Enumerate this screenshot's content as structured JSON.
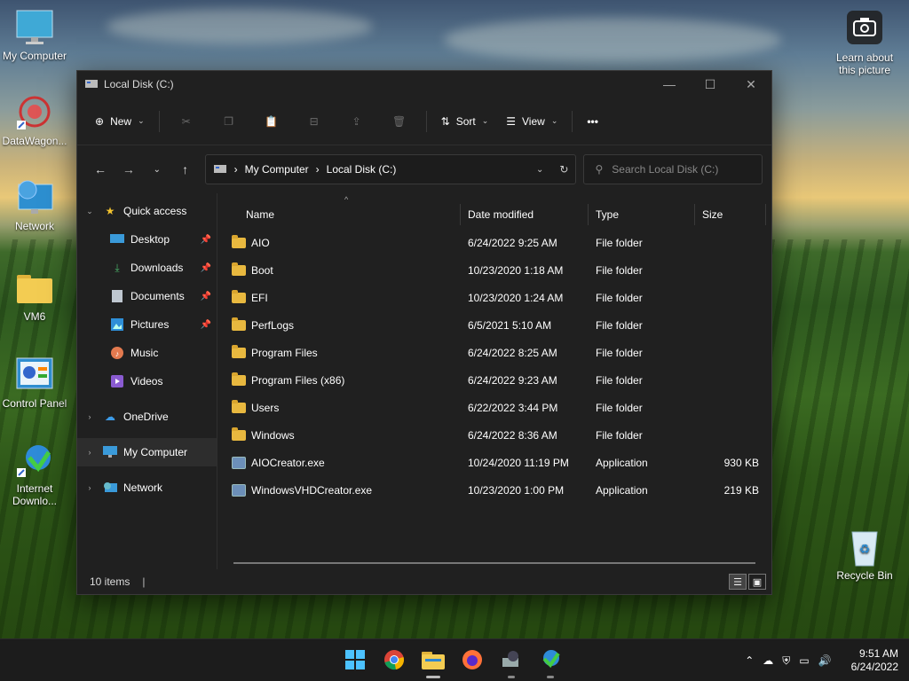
{
  "desktop": {
    "icons": [
      {
        "label": "My Computer"
      },
      {
        "label": "DataWagon..."
      },
      {
        "label": "Network"
      },
      {
        "label": "VM6"
      },
      {
        "label": "Control Panel"
      },
      {
        "label": "Internet Downlo..."
      },
      {
        "label": "Learn about this picture"
      },
      {
        "label": "Recycle Bin"
      }
    ]
  },
  "window": {
    "title": "Local Disk (C:)",
    "toolbar": {
      "new_label": "New",
      "sort_label": "Sort",
      "view_label": "View"
    },
    "address": {
      "crumbs": [
        "My Computer",
        "Local Disk (C:)"
      ],
      "search_placeholder": "Search Local Disk (C:)"
    },
    "nav": {
      "quick_access": "Quick access",
      "items": [
        {
          "label": "Desktop"
        },
        {
          "label": "Downloads"
        },
        {
          "label": "Documents"
        },
        {
          "label": "Pictures"
        },
        {
          "label": "Music"
        },
        {
          "label": "Videos"
        }
      ],
      "onedrive": "OneDrive",
      "my_computer": "My Computer",
      "network": "Network"
    },
    "columns": {
      "name": "Name",
      "date": "Date modified",
      "type": "Type",
      "size": "Size"
    },
    "files": [
      {
        "name": "AIO",
        "date": "6/24/2022 9:25 AM",
        "type": "File folder",
        "size": ""
      },
      {
        "name": "Boot",
        "date": "10/23/2020 1:18 AM",
        "type": "File folder",
        "size": ""
      },
      {
        "name": "EFI",
        "date": "10/23/2020 1:24 AM",
        "type": "File folder",
        "size": ""
      },
      {
        "name": "PerfLogs",
        "date": "6/5/2021 5:10 AM",
        "type": "File folder",
        "size": ""
      },
      {
        "name": "Program Files",
        "date": "6/24/2022 8:25 AM",
        "type": "File folder",
        "size": ""
      },
      {
        "name": "Program Files (x86)",
        "date": "6/24/2022 9:23 AM",
        "type": "File folder",
        "size": ""
      },
      {
        "name": "Users",
        "date": "6/22/2022 3:44 PM",
        "type": "File folder",
        "size": ""
      },
      {
        "name": "Windows",
        "date": "6/24/2022 8:36 AM",
        "type": "File folder",
        "size": ""
      },
      {
        "name": "AIOCreator.exe",
        "date": "10/24/2020 11:19 PM",
        "type": "Application",
        "size": "930 KB"
      },
      {
        "name": "WindowsVHDCreator.exe",
        "date": "10/23/2020 1:00 PM",
        "type": "Application",
        "size": "219 KB"
      }
    ],
    "status": {
      "count": "10 items",
      "separator": "|"
    }
  },
  "taskbar": {
    "time": "9:51 AM",
    "date": "6/24/2022"
  }
}
